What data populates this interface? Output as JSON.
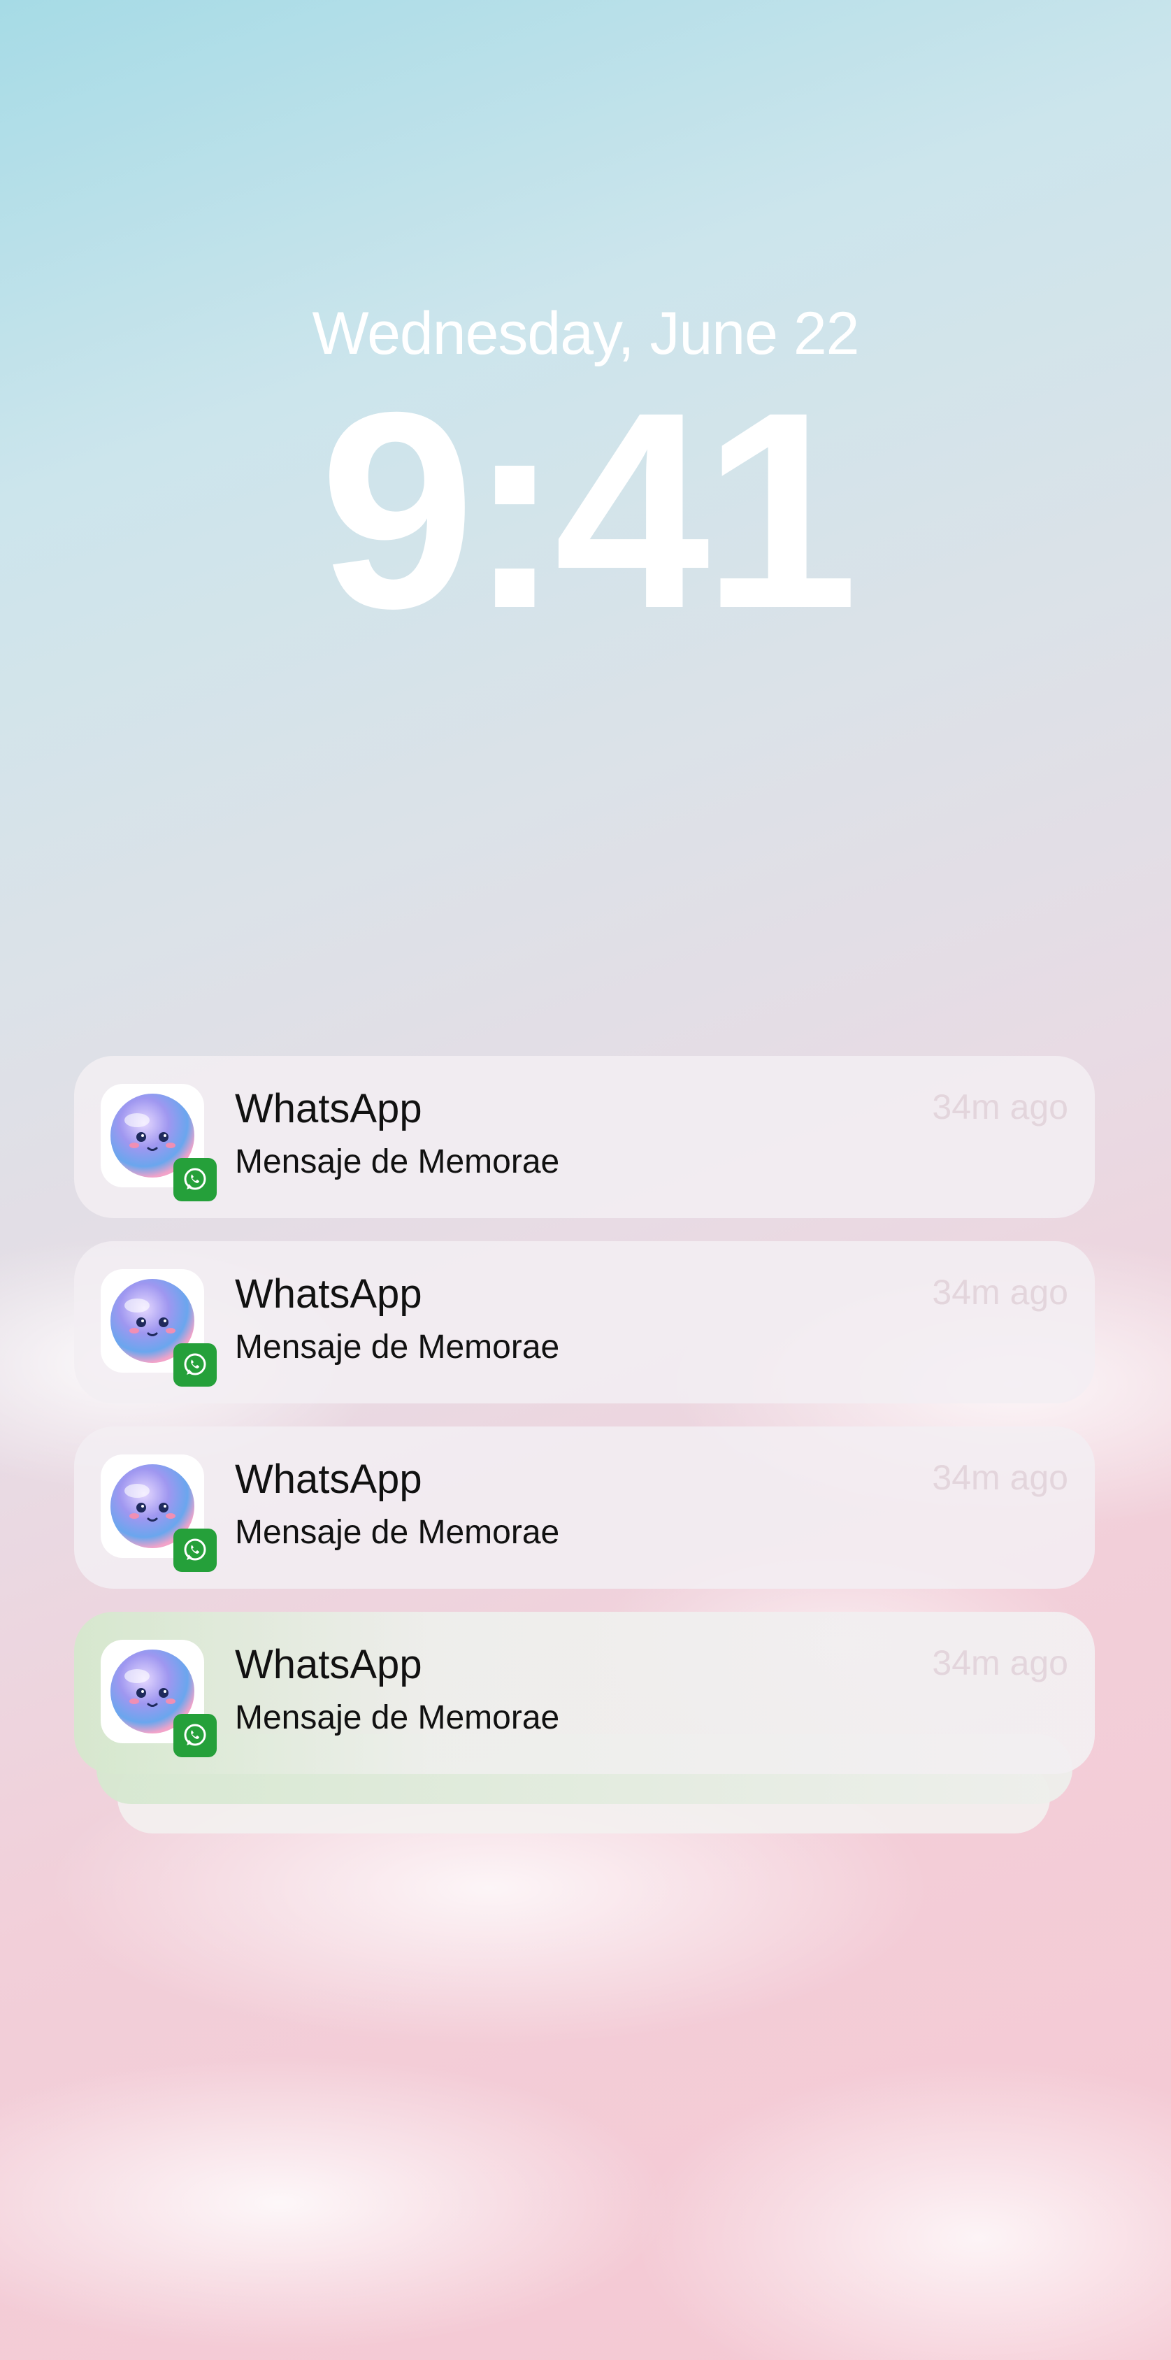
{
  "lockscreen": {
    "date": "Wednesday, June 22",
    "time": "9:41"
  },
  "notifications": [
    {
      "app": "WhatsApp",
      "message": "Mensaje de Memorae",
      "time_ago": "34m ago",
      "icon": "memorae-avatar-icon",
      "badge": "whatsapp-icon"
    },
    {
      "app": "WhatsApp",
      "message": "Mensaje de Memorae",
      "time_ago": "34m ago",
      "icon": "memorae-avatar-icon",
      "badge": "whatsapp-icon"
    },
    {
      "app": "WhatsApp",
      "message": "Mensaje de Memorae",
      "time_ago": "34m ago",
      "icon": "memorae-avatar-icon",
      "badge": "whatsapp-icon"
    },
    {
      "app": "WhatsApp",
      "message": "Mensaje de Memorae",
      "time_ago": "34m ago",
      "icon": "memorae-avatar-icon",
      "badge": "whatsapp-icon"
    }
  ],
  "colors": {
    "whatsapp_green": "#25a03a",
    "time_text": "#e3d5dc"
  }
}
